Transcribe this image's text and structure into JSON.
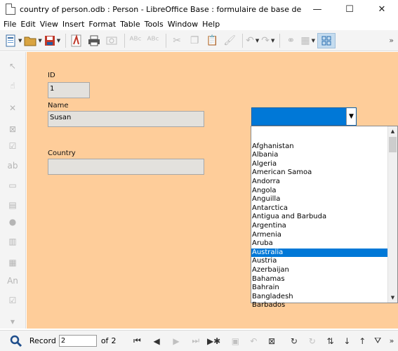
{
  "window": {
    "title": "country of person.odb : Person - LibreOffice Base : formulaire de base de données",
    "minimize": "—",
    "maximize": "☐",
    "close": "✕"
  },
  "menu": [
    "File",
    "Edit",
    "View",
    "Insert",
    "Format",
    "Table",
    "Tools",
    "Window",
    "Help"
  ],
  "form": {
    "id_label": "ID",
    "id_value": "1",
    "name_label": "Name",
    "name_value": "Susan",
    "country_label": "Country",
    "country_value": ""
  },
  "combo": {
    "selected_text": ""
  },
  "dropdown": {
    "options": [
      "",
      "Afghanistan",
      "Albania",
      "Algeria",
      "American Samoa",
      "Andorra",
      "Angola",
      "Anguilla",
      "Antarctica",
      "Antigua and Barbuda",
      "Argentina",
      "Armenia",
      "Aruba",
      "Australia",
      "Austria",
      "Azerbaijan",
      "Bahamas",
      "Bahrain",
      "Bangladesh",
      "Barbados"
    ],
    "selected": "Australia"
  },
  "navbar": {
    "record_label": "Record",
    "record_value": "2",
    "of_label": "of",
    "total": "2"
  },
  "colors": {
    "form_background": "#fecd9a",
    "selection": "#0078d7"
  }
}
